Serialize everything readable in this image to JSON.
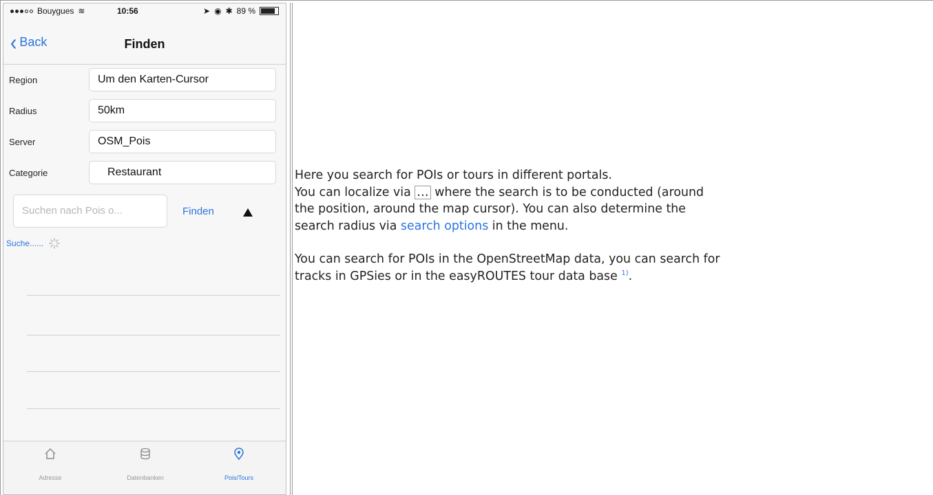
{
  "phone": {
    "status": {
      "carrier": "Bouygues",
      "time": "10:56",
      "battery": "89 %"
    },
    "nav": {
      "back_label": "Back",
      "title": "Finden"
    },
    "form": [
      {
        "label": "Region",
        "value": "Um den Karten-Cursor"
      },
      {
        "label": "Radius",
        "value": "50km"
      },
      {
        "label": "Server",
        "value": "OSM_Pois"
      },
      {
        "label": "Categorie",
        "value": "Restaurant"
      }
    ],
    "search": {
      "placeholder": "Suchen nach Pois o...",
      "button": "Finden",
      "status": "Suche......"
    },
    "tabs": [
      {
        "label": "Adresse",
        "icon": "home-icon"
      },
      {
        "label": "Datenbanken",
        "icon": "database-icon"
      },
      {
        "label": "Pois/Tours",
        "icon": "pin-icon"
      }
    ]
  },
  "text": {
    "line1": "Here you search for POIs or tours in different portals.",
    "line2_a": "You can localize via ",
    "line2_kbd": "…",
    "line2_b": " where the search is to be conducted (around",
    "line3": "the position, around the map cursor). You can also determine the",
    "line4_a": "search radius via ",
    "line4_link": "search options",
    "line4_b": " in the menu.",
    "line5": "You can search for POIs in the OpenStreetMap data, you can search for",
    "line6_a": "tracks in GPSies or in the easyROUTES tour data base ",
    "footnote": "1)",
    "line6_b": "."
  }
}
